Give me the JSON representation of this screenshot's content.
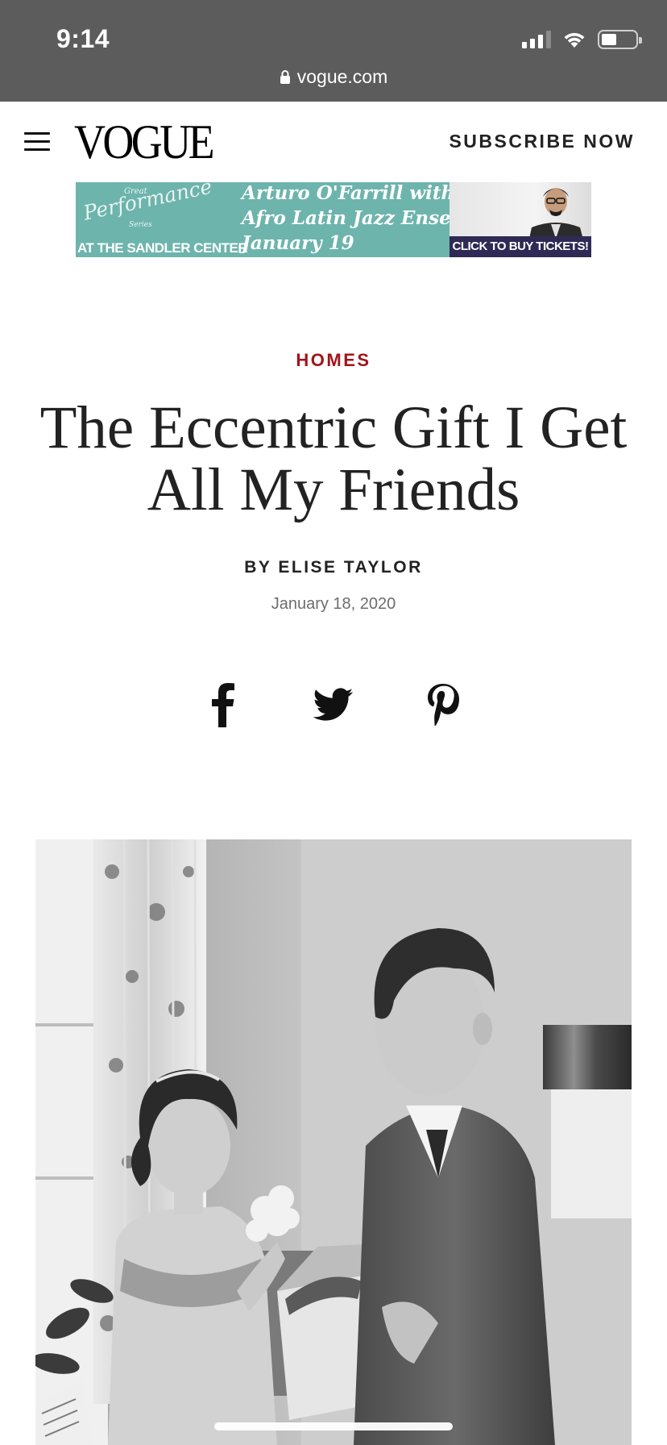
{
  "status_bar": {
    "time": "9:14"
  },
  "url_bar": {
    "domain": "vogue.com"
  },
  "header": {
    "logo": "VOGUE",
    "subscribe_label": "SUBSCRIBE NOW"
  },
  "ad": {
    "series_top": "Great",
    "series_name": "Performance",
    "series_bottom": "Series",
    "venue": "AT THE SANDLER CENTER",
    "line1": "Arturo O'Farrill with the",
    "line2": "Afro Latin Jazz Ensemble",
    "line3": "January 19",
    "cta": "CLICK TO BUY TICKETS!",
    "color": "#6db4ad"
  },
  "article": {
    "section": "HOMES",
    "title": "The Eccentric Gift I Get All My Friends",
    "byline": "BY ELISE TAYLOR",
    "date": "January 18, 2020",
    "accent_color": "#a1141a"
  },
  "share": {
    "icons": [
      "facebook-icon",
      "twitter-icon",
      "pinterest-icon"
    ]
  }
}
